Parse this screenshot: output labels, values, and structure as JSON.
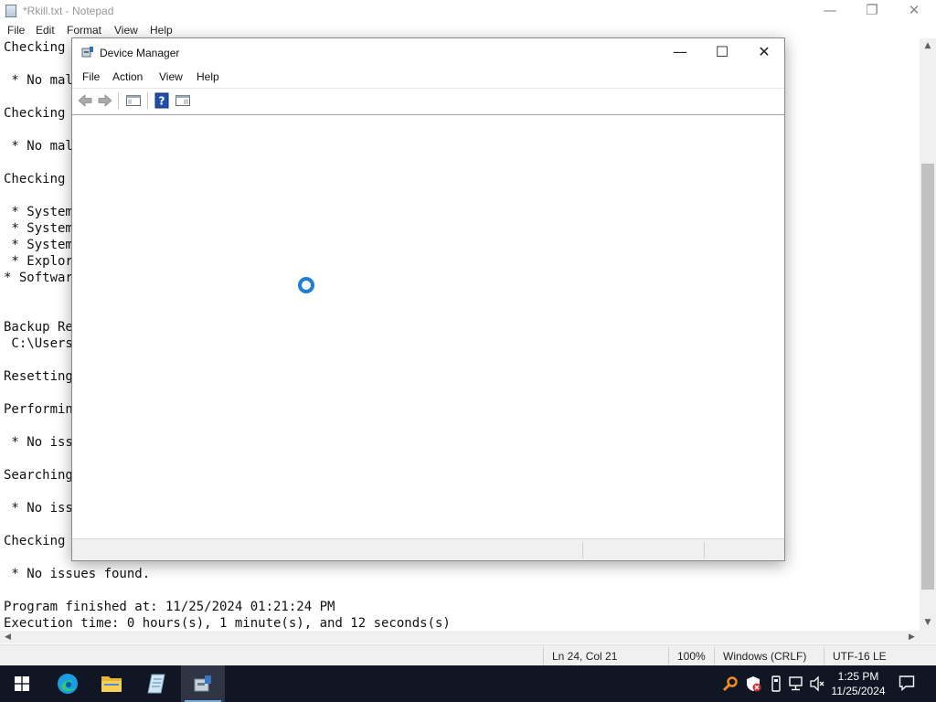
{
  "notepad": {
    "title": "*Rkill.txt - Notepad",
    "menu": [
      "File",
      "Edit",
      "Format",
      "View",
      "Help"
    ],
    "lines": [
      "Checking ",
      "",
      " * No malw",
      "",
      "Checking ",
      "",
      " * No malw",
      "",
      "Checking ",
      "",
      " * System",
      " * System",
      " * System",
      " * Explore",
      "* Software",
      "",
      "",
      "Backup Reg",
      " C:\\Users\\",
      "",
      "Resetting",
      "",
      "Performing",
      "",
      " * No issu",
      "",
      "Searching",
      "",
      " * No issu",
      "",
      "Checking ",
      "",
      " * No issues found.",
      "",
      "Program finished at: 11/25/2024 01:21:24 PM",
      "Execution time: 0 hours(s), 1 minute(s), and 12 seconds(s)"
    ],
    "status": {
      "position": "Ln 24, Col 21",
      "zoom": "100%",
      "line_ending": "Windows (CRLF)",
      "encoding": "UTF-16 LE"
    }
  },
  "device_manager": {
    "title": "Device Manager",
    "menu": [
      "File",
      "Action",
      "View",
      "Help"
    ],
    "toolbar": [
      "back-icon",
      "forward-icon",
      "show-hide-console-tree-icon",
      "help-icon",
      "properties-icon"
    ],
    "loading": true
  },
  "taskbar": {
    "apps": [
      "start-icon",
      "edge-icon",
      "file-explorer-icon",
      "notepad-icon",
      "device-manager-icon"
    ],
    "tray": [
      "search-tool-icon",
      "security-shield-icon",
      "usb-device-icon",
      "network-icon",
      "volume-muted-icon"
    ],
    "time": "1:25 PM",
    "date": "11/25/2024"
  },
  "colors": {
    "taskbar": "#101624",
    "spinner": "#1f7fd8"
  }
}
